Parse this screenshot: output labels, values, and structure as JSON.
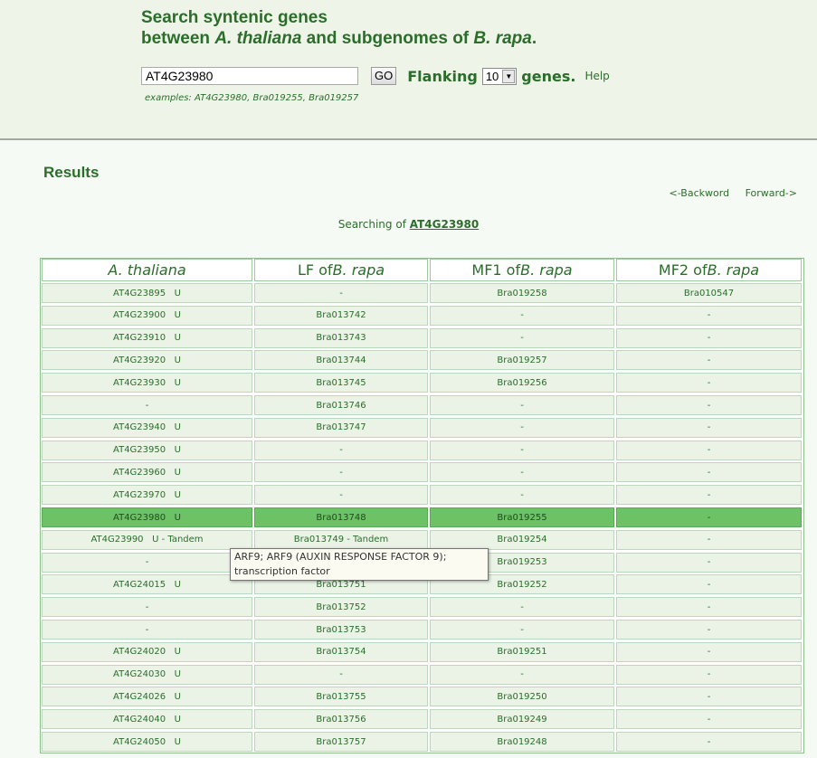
{
  "title": {
    "line1": "Search syntenic genes",
    "line2_a": "between ",
    "line2_b": "A. thaliana",
    "line2_c": " and subgenomes of ",
    "line2_d": "B. rapa",
    "line2_e": "."
  },
  "search": {
    "value": "AT4G23980",
    "go_label": "GO",
    "flanking_label": "Flanking",
    "flanking_value": "10",
    "genes_label": "genes.",
    "help_label": "Help",
    "examples": "examples: AT4G23980, Bra019255, Bra019257"
  },
  "results": {
    "title": "Results",
    "backward": "<-Backword",
    "forward": "Forward->",
    "searching_prefix": "Searching of ",
    "searching_query": "AT4G23980"
  },
  "table": {
    "headers": [
      {
        "main": "",
        "italic": "A. thaliana"
      },
      {
        "main": "LF of ",
        "italic": "B. rapa"
      },
      {
        "main": "MF1 of ",
        "italic": "B. rapa"
      },
      {
        "main": "MF2 of ",
        "italic": "B. rapa"
      }
    ],
    "rows": [
      [
        "AT4G23895   U",
        "-",
        "Bra019258",
        "Bra010547"
      ],
      [
        "AT4G23900   U",
        "Bra013742",
        "-",
        "-"
      ],
      [
        "AT4G23910   U",
        "Bra013743",
        "-",
        "-"
      ],
      [
        "AT4G23920   U",
        "Bra013744",
        "Bra019257",
        "-"
      ],
      [
        "AT4G23930   U",
        "Bra013745",
        "Bra019256",
        "-"
      ],
      [
        "-",
        "Bra013746",
        "-",
        "-"
      ],
      [
        "AT4G23940   U",
        "Bra013747",
        "-",
        "-"
      ],
      [
        "AT4G23950   U",
        "-",
        "-",
        "-"
      ],
      [
        "AT4G23960   U",
        "-",
        "-",
        "-"
      ],
      [
        "AT4G23970   U",
        "-",
        "-",
        "-"
      ],
      [
        "AT4G23980   U",
        "Bra013748",
        "Bra019255",
        "-"
      ],
      [
        "AT4G23990   U - Tandem",
        "Bra013749 - Tandem",
        "Bra019254",
        "-"
      ],
      [
        "-",
        "",
        "Bra019253",
        "-"
      ],
      [
        "AT4G24015   U",
        "Bra013751",
        "Bra019252",
        "-"
      ],
      [
        "-",
        "Bra013752",
        "-",
        "-"
      ],
      [
        "-",
        "Bra013753",
        "-",
        "-"
      ],
      [
        "AT4G24020   U",
        "Bra013754",
        "Bra019251",
        "-"
      ],
      [
        "AT4G24030   U",
        "-",
        "-",
        "-"
      ],
      [
        "AT4G24026   U",
        "Bra013755",
        "Bra019250",
        "-"
      ],
      [
        "AT4G24040   U",
        "Bra013756",
        "Bra019249",
        "-"
      ],
      [
        "AT4G24050   U",
        "Bra013757",
        "Bra019248",
        "-"
      ]
    ],
    "highlight_row": 10
  },
  "tooltip": {
    "line1": "ARF9; ARF9 (AUXIN RESPONSE FACTOR 9);",
    "line2": "transcription factor"
  },
  "colors": {
    "accent_green": "#2a6e2a",
    "highlight_green": "#6cc264",
    "cell_bg": "#eaf3e6",
    "page_bg": "#eef5e8"
  }
}
